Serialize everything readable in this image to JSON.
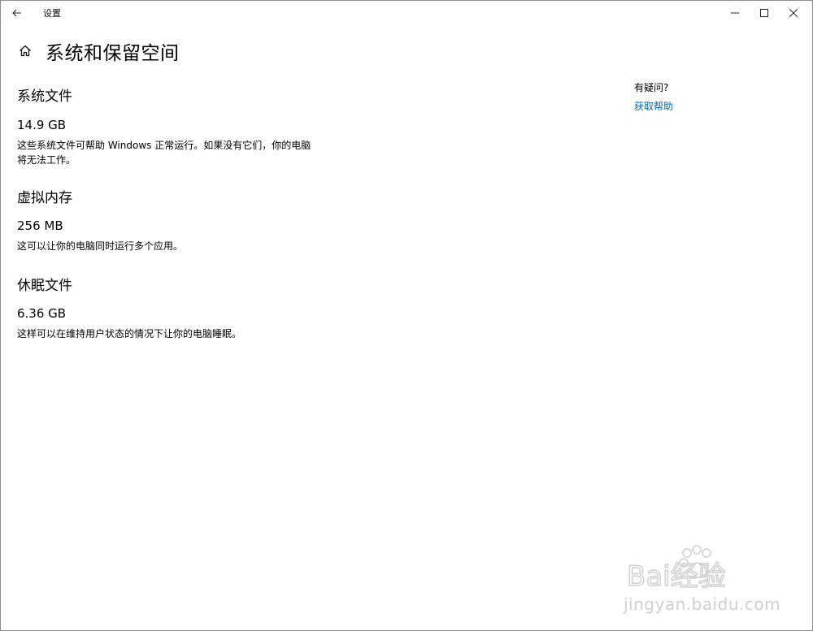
{
  "titlebar": {
    "app_title": "设置"
  },
  "page": {
    "title": "系统和保留空间"
  },
  "sections": [
    {
      "title": "系统文件",
      "size": "14.9 GB",
      "description_line1": "这些系统文件可帮助 Windows 正常运行。如果没有它们，你的电脑",
      "description_line2": "将无法工作。"
    },
    {
      "title": "虚拟内存",
      "size": "256 MB",
      "description_line1": "这可以让你的电脑同时运行多个应用。"
    },
    {
      "title": "休眠文件",
      "size": "6.36 GB",
      "description_line1": "这样可以在维持用户状态的情况下让你的电脑睡眠。"
    }
  ],
  "help": {
    "question": "有疑问?",
    "link": "获取帮助"
  },
  "watermark": {
    "brand": "Bai经验",
    "url": "jingyan.baidu.com"
  },
  "colors": {
    "accent": "#0067c0",
    "border": "#8c8c8c",
    "background": "#ffffff"
  }
}
